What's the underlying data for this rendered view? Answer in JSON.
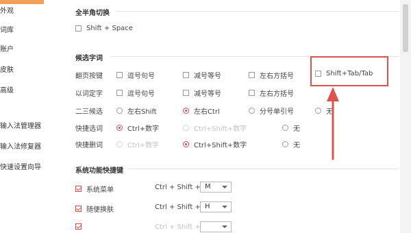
{
  "sidebar": {
    "items": [
      {
        "label": "外观"
      },
      {
        "label": "词库"
      },
      {
        "label": "账户"
      },
      {
        "label": "皮肤"
      },
      {
        "label": "高级"
      },
      {
        "label": "输入法管理器"
      },
      {
        "label": "输入法修复器"
      },
      {
        "label": "快速设置向导"
      }
    ]
  },
  "sections": {
    "fullhalf": {
      "title": "全半角切换",
      "option": "Shift + Space"
    },
    "candidates": {
      "title": "候选字词",
      "rows": [
        {
          "label": "翻页按键",
          "options": [
            "逗号句号",
            "减号等号",
            "左右方括号",
            "Shift+Tab/Tab"
          ]
        },
        {
          "label": "以词定字",
          "options": [
            "逗号句号",
            "减号等号",
            "左右方括号"
          ]
        },
        {
          "label": "二三候选",
          "options": [
            "左右Shift",
            "左右Ctrl",
            "分号单引号",
            "无"
          ]
        },
        {
          "label": "快捷选词",
          "options": [
            "Ctrl+数字",
            "Ctrl+Shift+数字",
            "无"
          ]
        },
        {
          "label": "快捷删词",
          "options": [
            "Ctrl+数字",
            "Ctrl+Shift+数字",
            "无"
          ]
        }
      ]
    },
    "hotkeys": {
      "title": "系统功能快捷键",
      "rows": [
        {
          "label": "系统菜单",
          "combo": "Ctrl + Shift +",
          "key": "M"
        },
        {
          "label": "随便换肤",
          "combo": "Ctrl + Shift +",
          "key": "H"
        },
        {
          "label": "",
          "combo": "Ctrl + Shift +",
          "key": ""
        }
      ]
    }
  },
  "colors": {
    "accent": "#d24a4a",
    "highlight": "#d9534f",
    "sidebar_accent": "#f3a15a"
  }
}
